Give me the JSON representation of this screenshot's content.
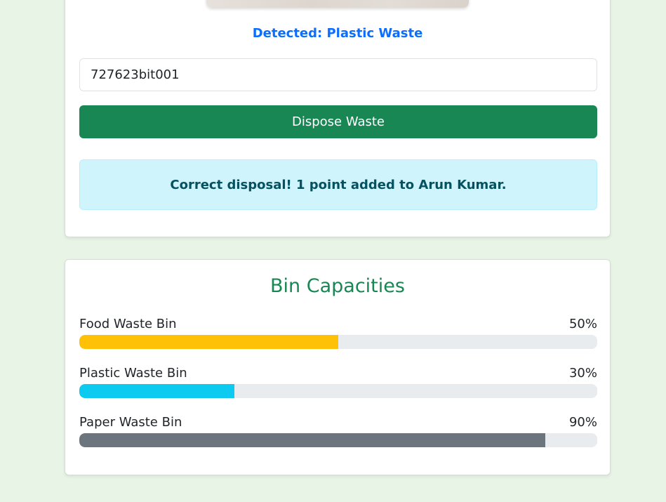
{
  "waste_card": {
    "detected_text": "Detected: Plastic Waste",
    "id_input_value": "727623bit001",
    "dispose_button_label": "Dispose Waste",
    "alert_message": "Correct disposal! 1 point added to Arun Kumar."
  },
  "bins_card": {
    "title": "Bin Capacities",
    "bins": [
      {
        "label": "Food Waste Bin",
        "percent_text": "50%",
        "fill": 0.5,
        "color": "#ffc107"
      },
      {
        "label": "Plastic Waste Bin",
        "percent_text": "30%",
        "fill": 0.3,
        "color": "#0dcaf0"
      },
      {
        "label": "Paper Waste Bin",
        "percent_text": "90%",
        "fill": 0.9,
        "color": "#6c757d"
      }
    ]
  },
  "colors": {
    "page_background": "#e8f5e6",
    "success": "#198754",
    "primary": "#0d6efd",
    "info_bg": "#cff4fc",
    "info_text": "#055160"
  }
}
